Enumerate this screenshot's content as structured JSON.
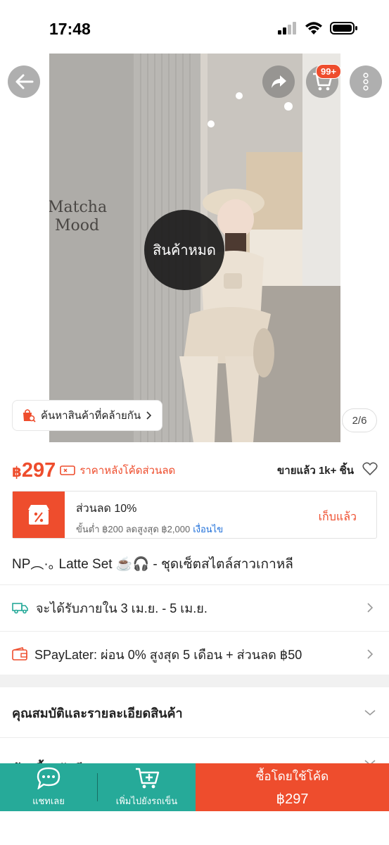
{
  "status_bar": {
    "time": "17:48"
  },
  "header": {
    "cart_badge": "99+"
  },
  "hero": {
    "sold_out_label": "สินค้าหมด",
    "find_similar_label": "ค้นหาสินค้าที่คล้ายกัน",
    "page_indicator": "2/6",
    "store_sign_line1": "Matcha",
    "store_sign_line2": "Mood"
  },
  "price": {
    "currency": "฿",
    "value": "297",
    "label": "ราคาหลังโค้ดส่วนลด",
    "sold_count": "ขายแล้ว 1k+ ชิ้น"
  },
  "voucher": {
    "title": "ส่วนลด 10%",
    "subtitle": "ขั้นต่ำ ฿200 ลดสูงสุด ฿2,000",
    "conditions_link": "เงื่อนไข",
    "action": "เก็บแล้ว"
  },
  "product": {
    "title": "NP︵·｡ Latte Set ☕️🎧 - ชุดเซ็ตสไตล์สาวเกาหลี"
  },
  "shipping": {
    "label": "จะได้รับภายใน 3 เม.ย. - 5 เม.ย."
  },
  "paylater": {
    "label": "SPayLater: ผ่อน 0% สูงสุด 5 เดือน + ส่วนลด ฿50"
  },
  "sections": {
    "specs": "คุณสมบัติและรายละเอียดสินค้า",
    "guarantee": "ช้อปปี้การันตี"
  },
  "bottom_bar": {
    "chat_label": "แชทเลย",
    "add_cart_label": "เพิ่มไปยังรถเข็น",
    "buy_label": "ซื้อโดยใช้โค้ด",
    "buy_price": "฿297"
  },
  "colors": {
    "accent": "#ee4d2d",
    "teal": "#26aa99",
    "link": "#1e6fd9"
  }
}
